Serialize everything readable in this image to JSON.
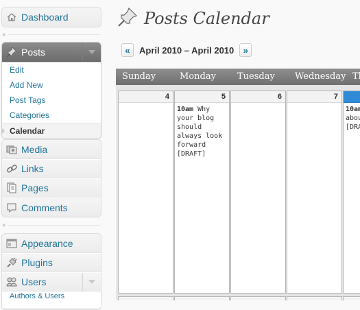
{
  "sidebar": {
    "dashboard": {
      "label": "Dashboard",
      "icon": "house-icon"
    },
    "posts": {
      "label": "Posts",
      "icon": "pushpin-icon",
      "submenu": [
        "Edit",
        "Add New",
        "Post Tags",
        "Categories",
        "Calendar"
      ],
      "current": "Calendar"
    },
    "group2": [
      {
        "label": "Media",
        "icon": "media-icon"
      },
      {
        "label": "Links",
        "icon": "link-icon"
      },
      {
        "label": "Pages",
        "icon": "pages-icon"
      },
      {
        "label": "Comments",
        "icon": "comment-icon"
      }
    ],
    "group3": [
      {
        "label": "Appearance",
        "icon": "appearance-icon"
      },
      {
        "label": "Plugins",
        "icon": "plug-icon"
      },
      {
        "label": "Users",
        "icon": "users-icon"
      }
    ],
    "users_sub_partial": "Authors & Users"
  },
  "page": {
    "title": "Posts Calendar",
    "title_icon": "pushpin-icon"
  },
  "nav": {
    "prev": "«",
    "range": "April 2010 – April 2010",
    "next": "»"
  },
  "calendar": {
    "day_names": [
      "Sunday",
      "Monday",
      "Tuesday",
      "Wednesday",
      "Th"
    ],
    "days": [
      {
        "num": "4",
        "events": []
      },
      {
        "num": "5",
        "events": [
          {
            "time": "10am",
            "text": "Why your blog should always look forward [DRAFT]"
          }
        ]
      },
      {
        "num": "6",
        "events": []
      },
      {
        "num": "7",
        "events": []
      },
      {
        "num": "",
        "today": true,
        "events": [
          {
            "time": "10am",
            "text": "spec abou (Go S [DRAF"
          }
        ]
      }
    ]
  },
  "colors": {
    "link": "#21759b",
    "header_gray": "#7a7a7a",
    "today_blue": "#2f8bd8"
  }
}
